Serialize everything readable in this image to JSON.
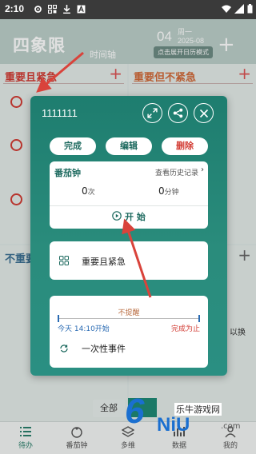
{
  "status": {
    "time": "2:10"
  },
  "header": {
    "title": "四象限",
    "timeline": "时间轴",
    "day": "04",
    "weekday": "周一",
    "year_month": "2025-08",
    "calendar_button": "点击展开日历模式",
    "add": "+"
  },
  "quadrants": {
    "q1": {
      "title": "重要且紧急",
      "add": "+"
    },
    "q2": {
      "title": "重要但不紧急",
      "add": "+"
    },
    "q3": {
      "title": "不重要",
      "add": "+"
    },
    "q4": {
      "add": "+",
      "hint": "以换"
    }
  },
  "filter_all": "全部",
  "dialog": {
    "task_name": "1111111",
    "complete": "完成",
    "edit": "编辑",
    "delete": "删除",
    "pomodoro": {
      "title": "番茄钟",
      "history": "查看历史记录",
      "count_value": "0",
      "count_unit": "次",
      "minutes_value": "0",
      "minutes_unit": "分钟",
      "start": "开 始"
    },
    "priority_label": "重要且紧急",
    "reminder": {
      "label": "不提醒",
      "start": "今天 14:10开始",
      "end": "完成为止"
    },
    "repeat_label": "一次性事件"
  },
  "bottom_nav": [
    {
      "label": "待办",
      "icon": "list-icon",
      "active": true
    },
    {
      "label": "番茄钟",
      "icon": "tomato-icon",
      "active": false
    },
    {
      "label": "多维",
      "icon": "layers-icon",
      "active": false
    },
    {
      "label": "数据",
      "icon": "chart-icon",
      "active": false
    },
    {
      "label": "我的",
      "icon": "user-icon",
      "active": false
    }
  ],
  "watermark": {
    "six": "6",
    "cn": "乐牛游戏网",
    "en": "NiU",
    "com": ".com"
  },
  "colors": {
    "accent": "#1e7d6f",
    "urgent_red": "#d23c34",
    "annotation_arrow": "#d9433b"
  }
}
